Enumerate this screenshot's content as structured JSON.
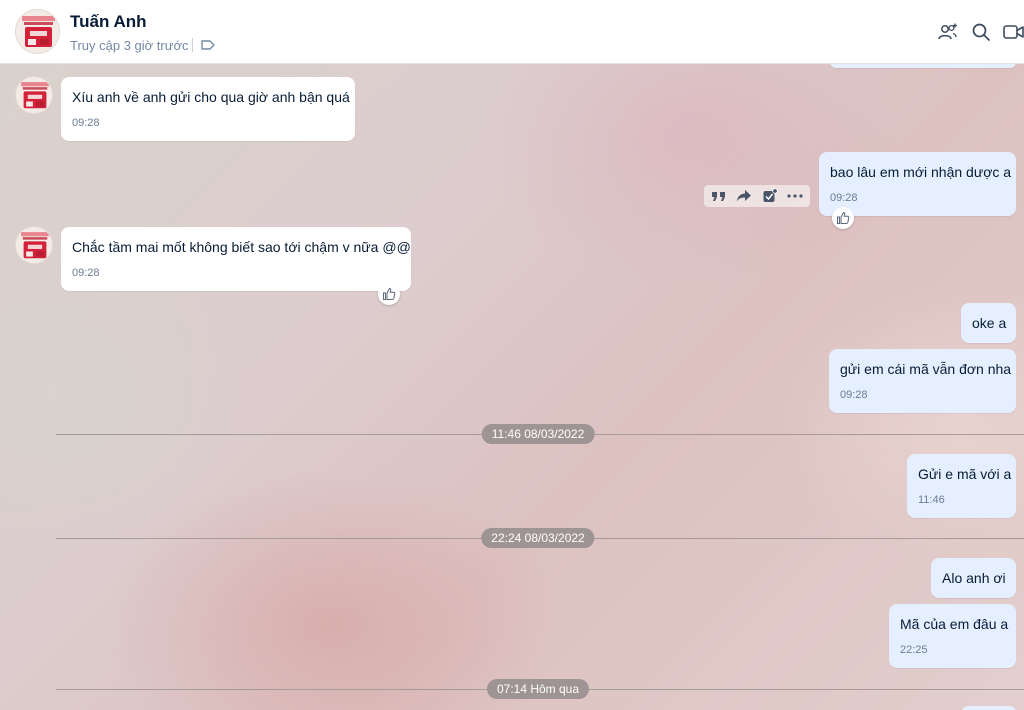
{
  "contact": {
    "name": "Tuấn Anh",
    "status": "Truy cập 3 giờ trước"
  },
  "header_icons": [
    "add-member-icon",
    "search-icon",
    "video-call-icon"
  ],
  "messages": [
    {
      "id": "m1",
      "direction": "incoming",
      "text": "Xíu anh về anh gửi cho qua giờ anh bận quá",
      "time": "09:28"
    },
    {
      "id": "m2",
      "direction": "outgoing",
      "text": "bao lâu em mới nhận dược a",
      "time": "09:28",
      "has_reaction_button": true
    },
    {
      "id": "m3",
      "direction": "incoming",
      "text": "Chắc tầm mai mốt không biết sao tới chậm v nữa @@",
      "time": "09:28",
      "has_reaction_button": true
    },
    {
      "id": "m4",
      "direction": "outgoing",
      "text": "oke a"
    },
    {
      "id": "m5",
      "direction": "outgoing",
      "text": "gửi em cái mã vẫn đơn nha",
      "time": "09:28"
    },
    {
      "id": "m6",
      "direction": "outgoing",
      "text": "Gửi e mã với a",
      "time": "11:46"
    },
    {
      "id": "m7",
      "direction": "outgoing",
      "text": "Alo anh ơi"
    },
    {
      "id": "m8",
      "direction": "outgoing",
      "text": "Mã của em đâu a",
      "time": "22:25"
    }
  ],
  "date_dividers": [
    {
      "label": "11:46 08/03/2022"
    },
    {
      "label": "22:24 08/03/2022"
    },
    {
      "label": "07:14 Hôm qua"
    }
  ],
  "message_action_icons": [
    "quote-icon",
    "forward-icon",
    "mark-task-icon",
    "more-icon"
  ],
  "colors": {
    "incoming_bubble": "#ffffff",
    "outgoing_bubble": "#e5efff",
    "date_pill": "#9e9494",
    "text_primary": "#081c36",
    "text_secondary": "#7589a3"
  }
}
